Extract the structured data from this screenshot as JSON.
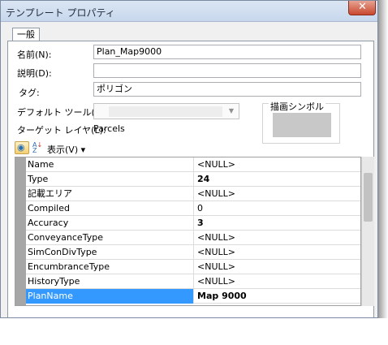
{
  "window": {
    "title": "テンプレート プロパティ",
    "close_glyph": "✕"
  },
  "tabs": [
    {
      "label": "一般"
    }
  ],
  "form": {
    "name_label": "名前(N):",
    "name_value": "Plan_Map9000",
    "description_label": "説明(D):",
    "description_value": "",
    "tag_label": "タグ:",
    "tag_value": "ポリゴン",
    "default_tool_label": "デフォルト ツール(T):",
    "default_tool_value": "",
    "target_layer_label": "ターゲット レイヤ(L):",
    "target_layer_value": "Parcels",
    "symbol_label": "描画シンボル"
  },
  "toolbar": {
    "categorized_icon": "categorized-view-icon",
    "sort_icon": "alphabetical-sort-icon",
    "sort_glyph": "A↓Z",
    "view_label": "表示(V) ▾"
  },
  "attributes": [
    {
      "name": "Name",
      "value": "<NULL>",
      "bold": false
    },
    {
      "name": "Type",
      "value": "24",
      "bold": true
    },
    {
      "name": "記載エリア",
      "value": "<NULL>",
      "bold": false
    },
    {
      "name": "Compiled",
      "value": "0",
      "bold": false
    },
    {
      "name": "Accuracy",
      "value": "3",
      "bold": true
    },
    {
      "name": "ConveyanceType",
      "value": "<NULL>",
      "bold": false
    },
    {
      "name": "SimConDivType",
      "value": "<NULL>",
      "bold": false
    },
    {
      "name": "EncumbranceType",
      "value": "<NULL>",
      "bold": false
    },
    {
      "name": "HistoryType",
      "value": "<NULL>",
      "bold": false
    },
    {
      "name": "PlanName",
      "value": "Map 9000",
      "bold": true,
      "selected": true
    }
  ],
  "colors": {
    "selection": "#3399ff",
    "gutter": "#a6a6a6",
    "close": "#c9482e"
  }
}
